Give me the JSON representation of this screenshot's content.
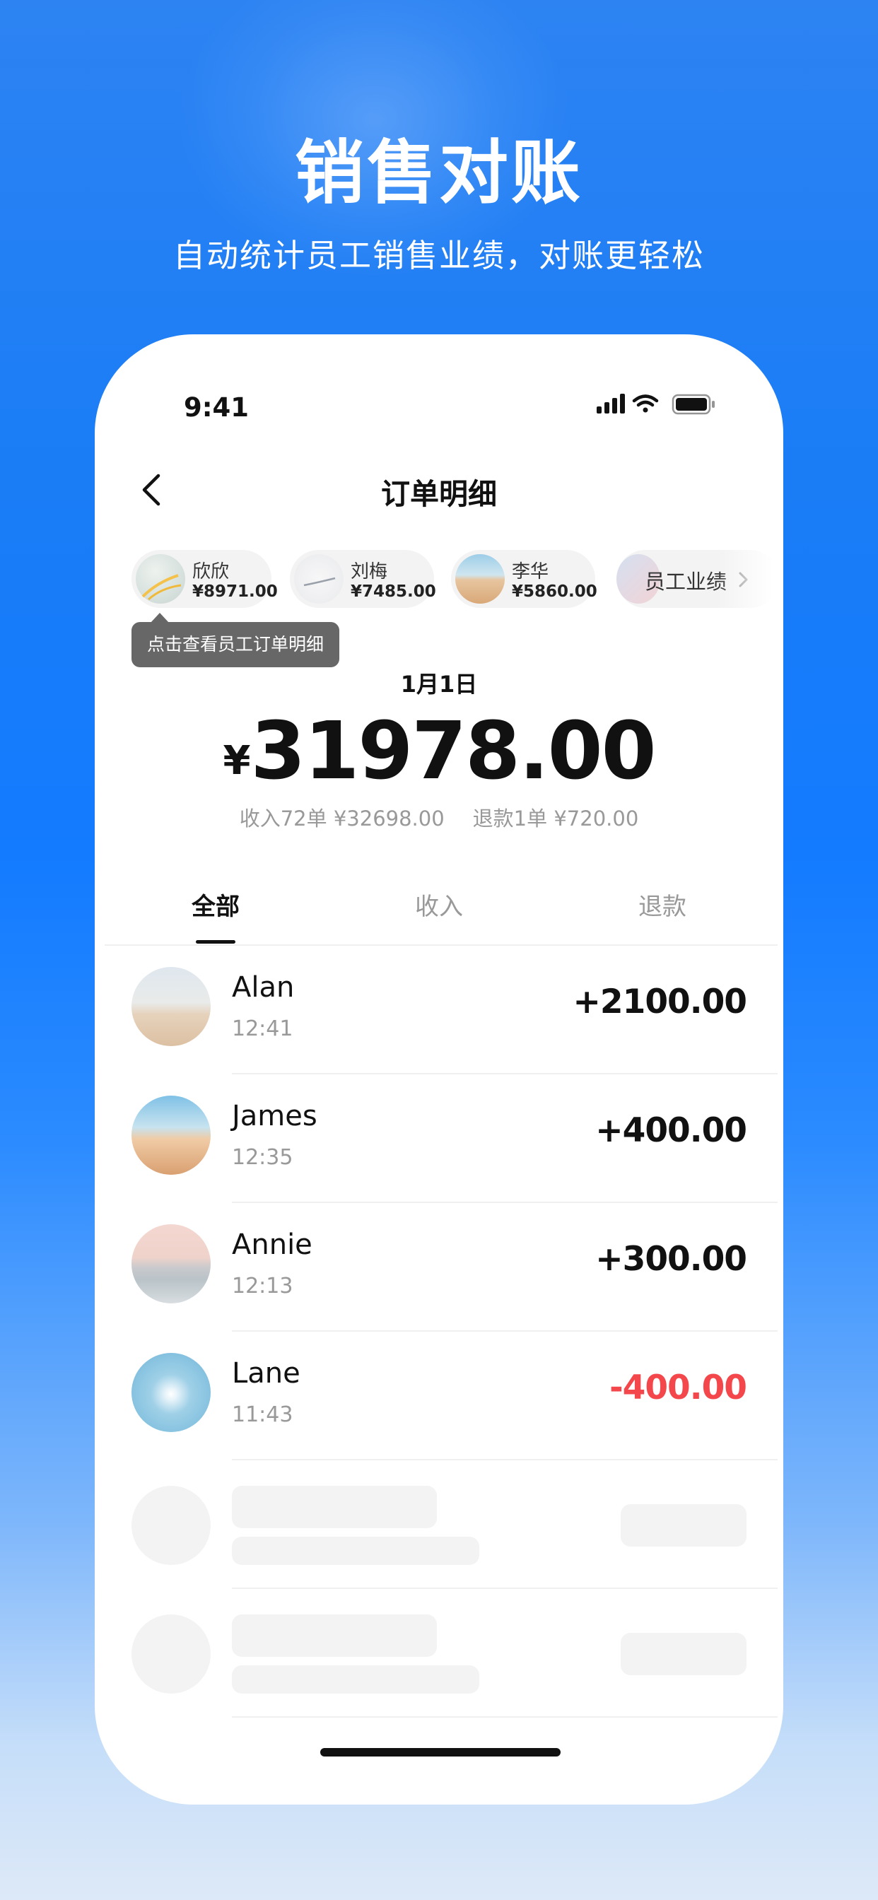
{
  "hero": {
    "title": "销售对账",
    "subtitle": "自动统计员工销售业绩，对账更轻松"
  },
  "status_bar": {
    "time": "9:41",
    "icons": [
      "signal-icon",
      "wifi-icon",
      "battery-icon"
    ]
  },
  "nav": {
    "title": "订单明细",
    "back_icon": "chevron-left-icon"
  },
  "employees": [
    {
      "name": "欣欣",
      "amount": "¥8971.00"
    },
    {
      "name": "刘梅",
      "amount": "¥7485.00"
    },
    {
      "name": "李华",
      "amount": "¥5860.00"
    }
  ],
  "employee_more_label": "员工业绩",
  "tooltip": "点击查看员工订单明细",
  "summary": {
    "date": "1月1日",
    "currency": "¥",
    "total": "31978.00",
    "income": "收入72单 ¥32698.00",
    "refund": "退款1单 ¥720.00"
  },
  "tabs": [
    {
      "label": "全部",
      "active": true
    },
    {
      "label": "收入",
      "active": false
    },
    {
      "label": "退款",
      "active": false
    }
  ],
  "orders": [
    {
      "name": "Alan",
      "time": "12:41",
      "amount": "+2100.00",
      "type": "income"
    },
    {
      "name": "James",
      "time": "12:35",
      "amount": "+400.00",
      "type": "income"
    },
    {
      "name": "Annie",
      "time": "12:13",
      "amount": "+300.00",
      "type": "income"
    },
    {
      "name": "Lane",
      "time": "11:43",
      "amount": "-400.00",
      "type": "refund"
    }
  ],
  "colors": {
    "primary_blue": "#137bff",
    "refund_red": "#f4474c",
    "text_primary": "#111111",
    "text_secondary": "#999999"
  }
}
